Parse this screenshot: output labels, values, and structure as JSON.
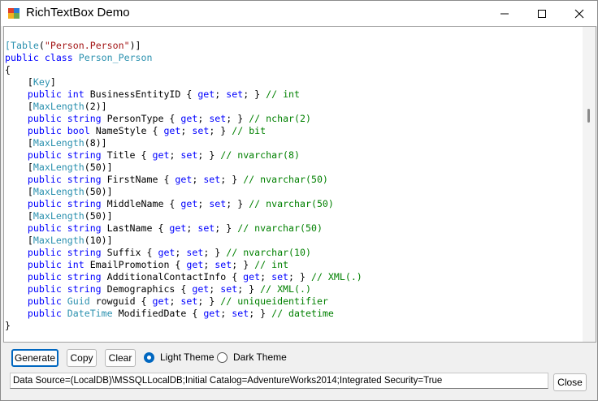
{
  "window": {
    "title": "RichTextBox Demo"
  },
  "editor": {
    "lines": [
      [
        {
          "c": "ty",
          "t": "["
        },
        {
          "c": "ty",
          "t": "Table"
        },
        {
          "c": "",
          "t": "("
        },
        {
          "c": "st",
          "t": "\"Person.Person\""
        },
        {
          "c": "",
          "t": ")]"
        }
      ],
      [
        {
          "c": "kw",
          "t": "public class "
        },
        {
          "c": "ty",
          "t": "Person_Person"
        }
      ],
      [
        {
          "c": "",
          "t": "{"
        }
      ],
      [
        {
          "c": "",
          "t": "    ["
        },
        {
          "c": "ty",
          "t": "Key"
        },
        {
          "c": "",
          "t": "]"
        }
      ],
      [
        {
          "c": "kw",
          "t": "    public int "
        },
        {
          "c": "",
          "t": "BusinessEntityID { "
        },
        {
          "c": "kw",
          "t": "get"
        },
        {
          "c": "",
          "t": "; "
        },
        {
          "c": "kw",
          "t": "set"
        },
        {
          "c": "",
          "t": "; } "
        },
        {
          "c": "cm",
          "t": "// int"
        }
      ],
      [
        {
          "c": "",
          "t": "    ["
        },
        {
          "c": "ty",
          "t": "MaxLength"
        },
        {
          "c": "",
          "t": "(2)]"
        }
      ],
      [
        {
          "c": "kw",
          "t": "    public string "
        },
        {
          "c": "",
          "t": "PersonType { "
        },
        {
          "c": "kw",
          "t": "get"
        },
        {
          "c": "",
          "t": "; "
        },
        {
          "c": "kw",
          "t": "set"
        },
        {
          "c": "",
          "t": "; } "
        },
        {
          "c": "cm",
          "t": "// nchar(2)"
        }
      ],
      [
        {
          "c": "kw",
          "t": "    public bool "
        },
        {
          "c": "",
          "t": "NameStyle { "
        },
        {
          "c": "kw",
          "t": "get"
        },
        {
          "c": "",
          "t": "; "
        },
        {
          "c": "kw",
          "t": "set"
        },
        {
          "c": "",
          "t": "; } "
        },
        {
          "c": "cm",
          "t": "// bit"
        }
      ],
      [
        {
          "c": "",
          "t": "    ["
        },
        {
          "c": "ty",
          "t": "MaxLength"
        },
        {
          "c": "",
          "t": "(8)]"
        }
      ],
      [
        {
          "c": "kw",
          "t": "    public string "
        },
        {
          "c": "",
          "t": "Title { "
        },
        {
          "c": "kw",
          "t": "get"
        },
        {
          "c": "",
          "t": "; "
        },
        {
          "c": "kw",
          "t": "set"
        },
        {
          "c": "",
          "t": "; } "
        },
        {
          "c": "cm",
          "t": "// nvarchar(8)"
        }
      ],
      [
        {
          "c": "",
          "t": "    ["
        },
        {
          "c": "ty",
          "t": "MaxLength"
        },
        {
          "c": "",
          "t": "(50)]"
        }
      ],
      [
        {
          "c": "kw",
          "t": "    public string "
        },
        {
          "c": "",
          "t": "FirstName { "
        },
        {
          "c": "kw",
          "t": "get"
        },
        {
          "c": "",
          "t": "; "
        },
        {
          "c": "kw",
          "t": "set"
        },
        {
          "c": "",
          "t": "; } "
        },
        {
          "c": "cm",
          "t": "// nvarchar(50)"
        }
      ],
      [
        {
          "c": "",
          "t": "    ["
        },
        {
          "c": "ty",
          "t": "MaxLength"
        },
        {
          "c": "",
          "t": "(50)]"
        }
      ],
      [
        {
          "c": "kw",
          "t": "    public string "
        },
        {
          "c": "",
          "t": "MiddleName { "
        },
        {
          "c": "kw",
          "t": "get"
        },
        {
          "c": "",
          "t": "; "
        },
        {
          "c": "kw",
          "t": "set"
        },
        {
          "c": "",
          "t": "; } "
        },
        {
          "c": "cm",
          "t": "// nvarchar(50)"
        }
      ],
      [
        {
          "c": "",
          "t": "    ["
        },
        {
          "c": "ty",
          "t": "MaxLength"
        },
        {
          "c": "",
          "t": "(50)]"
        }
      ],
      [
        {
          "c": "kw",
          "t": "    public string "
        },
        {
          "c": "",
          "t": "LastName { "
        },
        {
          "c": "kw",
          "t": "get"
        },
        {
          "c": "",
          "t": "; "
        },
        {
          "c": "kw",
          "t": "set"
        },
        {
          "c": "",
          "t": "; } "
        },
        {
          "c": "cm",
          "t": "// nvarchar(50)"
        }
      ],
      [
        {
          "c": "",
          "t": "    ["
        },
        {
          "c": "ty",
          "t": "MaxLength"
        },
        {
          "c": "",
          "t": "(10)]"
        }
      ],
      [
        {
          "c": "kw",
          "t": "    public string "
        },
        {
          "c": "",
          "t": "Suffix { "
        },
        {
          "c": "kw",
          "t": "get"
        },
        {
          "c": "",
          "t": "; "
        },
        {
          "c": "kw",
          "t": "set"
        },
        {
          "c": "",
          "t": "; } "
        },
        {
          "c": "cm",
          "t": "// nvarchar(10)"
        }
      ],
      [
        {
          "c": "kw",
          "t": "    public int "
        },
        {
          "c": "",
          "t": "EmailPromotion { "
        },
        {
          "c": "kw",
          "t": "get"
        },
        {
          "c": "",
          "t": "; "
        },
        {
          "c": "kw",
          "t": "set"
        },
        {
          "c": "",
          "t": "; } "
        },
        {
          "c": "cm",
          "t": "// int"
        }
      ],
      [
        {
          "c": "kw",
          "t": "    public string "
        },
        {
          "c": "",
          "t": "AdditionalContactInfo { "
        },
        {
          "c": "kw",
          "t": "get"
        },
        {
          "c": "",
          "t": "; "
        },
        {
          "c": "kw",
          "t": "set"
        },
        {
          "c": "",
          "t": "; } "
        },
        {
          "c": "cm",
          "t": "// XML(.)"
        }
      ],
      [
        {
          "c": "kw",
          "t": "    public string "
        },
        {
          "c": "",
          "t": "Demographics { "
        },
        {
          "c": "kw",
          "t": "get"
        },
        {
          "c": "",
          "t": "; "
        },
        {
          "c": "kw",
          "t": "set"
        },
        {
          "c": "",
          "t": "; } "
        },
        {
          "c": "cm",
          "t": "// XML(.)"
        }
      ],
      [
        {
          "c": "kw",
          "t": "    public "
        },
        {
          "c": "ty",
          "t": "Guid "
        },
        {
          "c": "",
          "t": "rowguid { "
        },
        {
          "c": "kw",
          "t": "get"
        },
        {
          "c": "",
          "t": "; "
        },
        {
          "c": "kw",
          "t": "set"
        },
        {
          "c": "",
          "t": "; } "
        },
        {
          "c": "cm",
          "t": "// uniqueidentifier"
        }
      ],
      [
        {
          "c": "kw",
          "t": "    public "
        },
        {
          "c": "ty",
          "t": "DateTime "
        },
        {
          "c": "",
          "t": "ModifiedDate { "
        },
        {
          "c": "kw",
          "t": "get"
        },
        {
          "c": "",
          "t": "; "
        },
        {
          "c": "kw",
          "t": "set"
        },
        {
          "c": "",
          "t": "; } "
        },
        {
          "c": "cm",
          "t": "// datetime"
        }
      ],
      [
        {
          "c": "",
          "t": "}"
        }
      ]
    ]
  },
  "toolbar": {
    "generate_label": "Generate",
    "copy_label": "Copy",
    "clear_label": "Clear",
    "light_theme_label": "Light Theme",
    "dark_theme_label": "Dark Theme",
    "selected_theme": "light",
    "close_label": "Close"
  },
  "connection": {
    "value": "Data Source=(LocalDB)\\MSSQLLocalDB;Initial Catalog=AdventureWorks2014;Integrated Security=True"
  },
  "icons": {
    "app": "app-icon",
    "minimize": "minimize-icon",
    "maximize": "maximize-icon",
    "close": "close-icon"
  },
  "colors": {
    "keyword": "#0000ff",
    "type": "#2b91af",
    "string": "#a31515",
    "comment": "#008000",
    "accent": "#0067c0"
  }
}
